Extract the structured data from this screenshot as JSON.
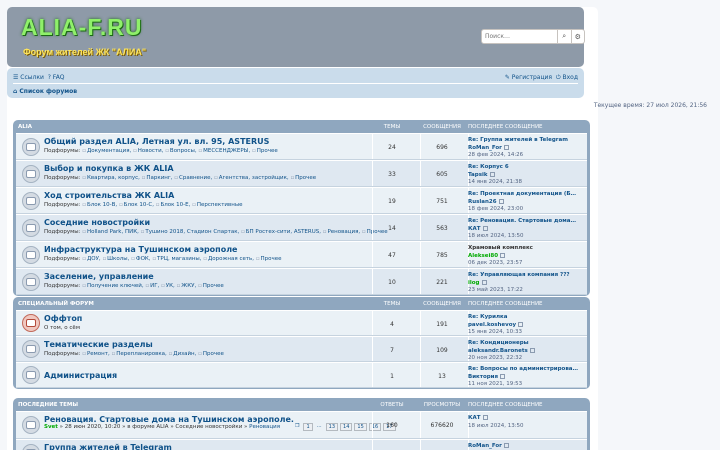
{
  "header": {
    "logo": "ALIA-F.RU",
    "tagline": "Форум жителей ЖК \"АЛИА\"",
    "search_placeholder": "Поиск…"
  },
  "nav": {
    "links": "Ссылки",
    "faq": "FAQ",
    "register": "Регистрация",
    "login": "Вход",
    "breadcrumb": "Список форумов"
  },
  "current_time": "Текущее время: 27 июл 2026, 21:56",
  "colors": {
    "link": "#105289",
    "header_bg": "#8e9aa8",
    "navbar_bg": "#cadceb",
    "category_bg": "#8fa7bf"
  },
  "cat1": {
    "title": "ALIA",
    "col_topics": "ТЕМЫ",
    "col_posts": "СООБЩЕНИЯ",
    "col_last": "ПОСЛЕДНЕЕ СООБЩЕНИЕ",
    "forums": [
      {
        "title": "Общий раздел ALIA, Летная ул. вл. 95, ASTERUS",
        "sub_label": "Подфорумы:",
        "subs": [
          "Документация,",
          "Новости,",
          "Вопросы,",
          "МЕССЕНДЖЕРЫ,",
          "Прочее"
        ],
        "topics": "24",
        "posts": "696",
        "last_title": "Re: Группа жителей в Telegram",
        "last_user": "RoMan_For",
        "last_date": "28 фев 2024, 14:26"
      },
      {
        "title": "Выбор и покупка в ЖК ALIA",
        "sub_label": "Подфорумы:",
        "subs": [
          "Квартира, корпус,",
          "Паркинг,",
          "Сравнение,",
          "Агентства, застройщик,",
          "Прочее"
        ],
        "topics": "33",
        "posts": "605",
        "last_title": "Re: Корпус 6",
        "last_user": "Tapsik",
        "last_date": "14 янв 2024, 21:38"
      },
      {
        "title": "Ход строительства ЖК ALIA",
        "sub_label": "Подфорумы:",
        "subs": [
          "Блок 10-В,",
          "Блок 10-С,",
          "Блок 10-Е,",
          "Перспективные"
        ],
        "topics": "19",
        "posts": "751",
        "last_title": "Re: Проектная документация (Б…",
        "last_user": "Ruslan26",
        "last_date": "18 фев 2024, 23:00"
      },
      {
        "title": "Соседние новостройки",
        "sub_label": "Подфорумы:",
        "subs": [
          "Holland Park, ПИК,",
          "Тушино 2018, Стадион Спартак,",
          "БП Ростех-сити, ASTERUS,",
          "Реновация,",
          "Прочее"
        ],
        "topics": "14",
        "posts": "563",
        "last_title": "Re: Реновация. Стартовые дома…",
        "last_user": "КАТ",
        "last_date": "18 июл 2024, 13:50"
      },
      {
        "title": "Инфраструктура на Тушинском аэрополе",
        "sub_label": "Подфорумы:",
        "subs": [
          "ДОУ,",
          "Школы,",
          "ФОК,",
          "ТРЦ, магазины,",
          "Дорожная сеть,",
          "Прочее"
        ],
        "topics": "47",
        "posts": "785",
        "last_title": "Храмовый комплекс",
        "last_user": "Aleksei80",
        "last_date": "06 дек 2023, 23:57"
      },
      {
        "title": "Заселение, управление",
        "sub_label": "Подфорумы:",
        "subs": [
          "Получение ключей,",
          "ИГ,",
          "УК,",
          "ЖКУ,",
          "Прочее"
        ],
        "topics": "10",
        "posts": "221",
        "last_title": "Re: Управляющая компания ???",
        "last_user": "ilog",
        "last_date": "23 май 2023, 17:22"
      }
    ]
  },
  "cat2": {
    "title": "СПЕЦИАЛЬНЫЙ ФОРУМ",
    "col_topics": "ТЕМЫ",
    "col_posts": "СООБЩЕНИЯ",
    "col_last": "ПОСЛЕДНЕЕ СООБЩЕНИЕ",
    "forums": [
      {
        "title": "Оффтоп",
        "desc": "О том, о сём",
        "topics": "4",
        "posts": "191",
        "last_title": "Re: Курилка",
        "last_user": "pavel.koshevoy",
        "last_date": "15 янв 2024, 10:33"
      },
      {
        "title": "Тематические разделы",
        "sub_label": "Подфорумы:",
        "subs": [
          "Ремонт,",
          "Перепланировка,",
          "Дизайн,",
          "Прочее"
        ],
        "topics": "7",
        "posts": "109",
        "last_title": "Re: Кондиционеры",
        "last_user": "aleksandr.Baronets",
        "last_date": "20 ноя 2023, 22:32"
      },
      {
        "title": "Администрация",
        "topics": "1",
        "posts": "13",
        "last_title": "Re: Вопросы по администрирова…",
        "last_user": "Виктория",
        "last_date": "11 ноя 2021, 19:53"
      }
    ]
  },
  "cat3": {
    "title": "ПОСЛЕДНИЕ ТЕМЫ",
    "col_replies": "ОТВЕТЫ",
    "col_views": "ПРОСМОТРЫ",
    "col_last": "ПОСЛЕДНЕЕ СООБЩЕНИЕ",
    "topics": [
      {
        "title": "Реновация. Стартовые дома на Тушинском аэрополе.",
        "user": "Svet",
        "meta": "» 28 июн 2020, 10:20 » в форуме ALIA » Соседние новостройки »",
        "meta2": "Реновация",
        "pages": [
          "1",
          "…",
          "13",
          "14",
          "15",
          "16",
          "17"
        ],
        "replies": "160",
        "views": "676620",
        "last_user": "КАТ",
        "last_date": "18 июл 2024, 13:50"
      },
      {
        "title": "Группа жителей в Telegram",
        "replies": "149",
        "views": "776466",
        "last_user": "RoMan_For"
      }
    ]
  }
}
